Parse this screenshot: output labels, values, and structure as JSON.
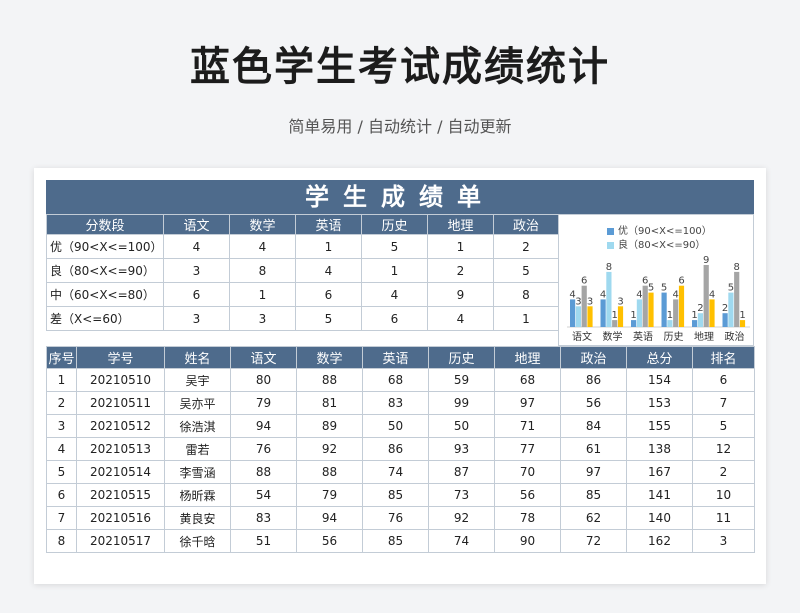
{
  "title": "蓝色学生考试成绩统计",
  "subtitle": "简单易用 / 自动统计 / 自动更新",
  "banner": "学生成绩单",
  "summary": {
    "header": [
      "分数段",
      "语文",
      "数学",
      "英语",
      "历史",
      "地理",
      "政治"
    ],
    "rows": [
      {
        "label": "优（90<X<=100）",
        "values": [
          4,
          4,
          1,
          5,
          1,
          2
        ]
      },
      {
        "label": "良（80<X<=90）",
        "values": [
          3,
          8,
          4,
          1,
          2,
          5
        ]
      },
      {
        "label": "中（60<X<=80）",
        "values": [
          6,
          1,
          6,
          4,
          9,
          8
        ]
      },
      {
        "label": "差（X<=60）",
        "values": [
          3,
          3,
          5,
          6,
          4,
          1
        ]
      }
    ]
  },
  "colors": {
    "header_bg": "#4e6b8c",
    "excellent": "#5b9bd5",
    "good": "#9fd9ef",
    "medium": "#a5a5a5",
    "poor": "#ffc000"
  },
  "chart_data": {
    "type": "bar",
    "categories": [
      "语文",
      "数学",
      "英语",
      "历史",
      "地理",
      "政治"
    ],
    "series": [
      {
        "name": "优（90<X<=100）",
        "values": [
          4,
          4,
          1,
          5,
          1,
          2
        ]
      },
      {
        "name": "良（80<X<=90）",
        "values": [
          3,
          8,
          4,
          1,
          2,
          5
        ]
      },
      {
        "values": [
          6,
          1,
          6,
          4,
          9,
          8
        ]
      },
      {
        "values": [
          3,
          3,
          5,
          6,
          4,
          1
        ]
      }
    ],
    "legend": "top",
    "data_labels": true,
    "ylim": [
      0,
      9
    ]
  },
  "table": {
    "columns": [
      "序号",
      "学号",
      "姓名",
      "语文",
      "数学",
      "英语",
      "历史",
      "地理",
      "政治",
      "总分",
      "排名"
    ],
    "rows": [
      [
        "1",
        "20210510",
        "吴宇",
        "80",
        "88",
        "68",
        "59",
        "68",
        "86",
        "154",
        "6"
      ],
      [
        "2",
        "20210511",
        "吴亦平",
        "79",
        "81",
        "83",
        "99",
        "97",
        "56",
        "153",
        "7"
      ],
      [
        "3",
        "20210512",
        "徐浩淇",
        "94",
        "89",
        "50",
        "50",
        "71",
        "84",
        "155",
        "5"
      ],
      [
        "4",
        "20210513",
        "雷若",
        "76",
        "92",
        "86",
        "93",
        "77",
        "61",
        "138",
        "12"
      ],
      [
        "5",
        "20210514",
        "李雪涵",
        "88",
        "88",
        "74",
        "87",
        "70",
        "97",
        "167",
        "2"
      ],
      [
        "6",
        "20210515",
        "杨昕霖",
        "54",
        "79",
        "85",
        "73",
        "56",
        "85",
        "141",
        "10"
      ],
      [
        "7",
        "20210516",
        "黄良安",
        "83",
        "94",
        "76",
        "92",
        "78",
        "62",
        "140",
        "11"
      ],
      [
        "8",
        "20210517",
        "徐千晗",
        "51",
        "56",
        "85",
        "74",
        "90",
        "72",
        "162",
        "3"
      ]
    ]
  }
}
